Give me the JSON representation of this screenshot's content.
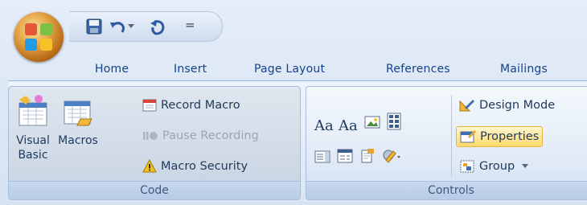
{
  "tabs": [
    "Home",
    "Insert",
    "Page Layout",
    "References",
    "Mailings"
  ],
  "qat": {
    "customize_glyph": "="
  },
  "code_group": {
    "label": "Code",
    "visual_basic_line1": "Visual",
    "visual_basic_line2": "Basic",
    "macros": "Macros",
    "record_macro": "Record Macro",
    "pause_recording": "Pause Recording",
    "macro_security": "Macro Security"
  },
  "controls_group": {
    "label": "Controls",
    "aa1": "Aa",
    "aa2": "Aa",
    "design_mode": "Design Mode",
    "properties": "Properties",
    "group": "Group"
  },
  "icons": [
    "office-button-icon",
    "save-icon",
    "undo-icon",
    "redo-icon",
    "visual-basic-icon",
    "macros-icon",
    "record-macro-icon",
    "pause-icon",
    "warning-icon",
    "image-control-icon",
    "combo-box-icon",
    "list-box-icon",
    "text-box-icon",
    "tools-icon",
    "design-mode-icon",
    "properties-icon",
    "group-icon"
  ],
  "colors": {
    "tab_text": "#15428b",
    "selected_button": "#ffd96a",
    "ribbon_border": "#a6bddb"
  }
}
